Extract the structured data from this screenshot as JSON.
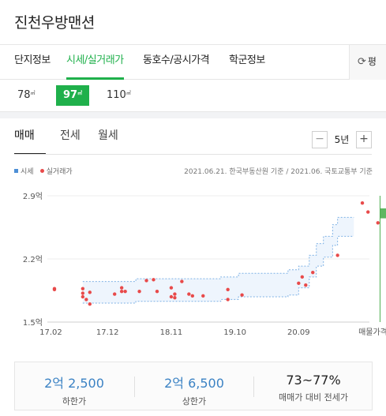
{
  "app": {
    "title": "진천우방맨션"
  },
  "tabs": [
    {
      "label": "단지정보",
      "active": false
    },
    {
      "label": "시세/실거래가",
      "active": true
    },
    {
      "label": "동호수/공시가격",
      "active": false
    },
    {
      "label": "학군정보",
      "active": false
    }
  ],
  "side_tab": {
    "icon": "refresh-icon",
    "label": "평"
  },
  "sizes": [
    {
      "label": "78",
      "unit": "㎡",
      "active": false
    },
    {
      "label": "97",
      "unit": "㎡",
      "active": true
    },
    {
      "label": "110",
      "unit": "㎡",
      "active": false
    }
  ],
  "deal_tabs": [
    {
      "label": "매매",
      "active": true
    },
    {
      "label": "전세",
      "active": false
    },
    {
      "label": "월세",
      "active": false
    }
  ],
  "period": {
    "minus": "−",
    "label": "5년",
    "plus": "+"
  },
  "legend": {
    "market": "시세",
    "actual": "실거래가"
  },
  "source_note": "2021.06.21. 한국부동산원 기준 / 2021.06. 국토교통부 기준",
  "chart_data": {
    "type": "line",
    "yticks": [
      "2.9억",
      "2.2억",
      "1.5억"
    ],
    "ylim": [
      1.5,
      2.9
    ],
    "xticks": [
      "17.02",
      "17.12",
      "18.11",
      "19.10",
      "20.09",
      "매물가격"
    ],
    "xlim": [
      2017.05,
      2021.6
    ],
    "series": [
      {
        "name": "시세",
        "band_upper": [
          [
            2017.55,
            1.95
          ],
          [
            2018.3,
            1.95
          ],
          [
            2018.3,
            1.98
          ],
          [
            2019.5,
            1.98
          ],
          [
            2019.5,
            2.0
          ],
          [
            2019.75,
            2.0
          ],
          [
            2019.75,
            2.04
          ],
          [
            2020.45,
            2.04
          ],
          [
            2020.45,
            2.08
          ],
          [
            2020.6,
            2.08
          ],
          [
            2020.6,
            2.12
          ],
          [
            2020.75,
            2.12
          ],
          [
            2020.75,
            2.24
          ],
          [
            2020.85,
            2.24
          ],
          [
            2020.85,
            2.37
          ],
          [
            2020.95,
            2.37
          ],
          [
            2020.95,
            2.45
          ],
          [
            2021.08,
            2.45
          ],
          [
            2021.08,
            2.58
          ],
          [
            2021.15,
            2.58
          ],
          [
            2021.15,
            2.66
          ],
          [
            2021.38,
            2.66
          ]
        ],
        "band_lower": [
          [
            2017.55,
            1.71
          ],
          [
            2018.3,
            1.71
          ],
          [
            2018.3,
            1.73
          ],
          [
            2019.5,
            1.73
          ],
          [
            2019.5,
            1.75
          ],
          [
            2019.75,
            1.75
          ],
          [
            2019.75,
            1.78
          ],
          [
            2020.45,
            1.78
          ],
          [
            2020.45,
            1.8
          ],
          [
            2020.6,
            1.8
          ],
          [
            2020.6,
            1.88
          ],
          [
            2020.75,
            1.88
          ],
          [
            2020.75,
            2.0
          ],
          [
            2020.85,
            2.0
          ],
          [
            2020.85,
            2.12
          ],
          [
            2020.95,
            2.12
          ],
          [
            2020.95,
            2.22
          ],
          [
            2021.08,
            2.22
          ],
          [
            2021.08,
            2.35
          ],
          [
            2021.15,
            2.35
          ],
          [
            2021.15,
            2.45
          ],
          [
            2021.38,
            2.45
          ]
        ]
      },
      {
        "name": "실거래가",
        "points": [
          [
            2017.15,
            1.87
          ],
          [
            2017.15,
            1.86
          ],
          [
            2017.55,
            1.87
          ],
          [
            2017.55,
            1.82
          ],
          [
            2017.55,
            1.78
          ],
          [
            2017.6,
            1.75
          ],
          [
            2017.65,
            1.83
          ],
          [
            2017.65,
            1.7
          ],
          [
            2018.0,
            1.81
          ],
          [
            2018.1,
            1.84
          ],
          [
            2018.1,
            1.88
          ],
          [
            2018.15,
            1.84
          ],
          [
            2018.35,
            1.84
          ],
          [
            2018.45,
            1.96
          ],
          [
            2018.55,
            1.97
          ],
          [
            2018.6,
            1.84
          ],
          [
            2018.8,
            1.88
          ],
          [
            2018.8,
            1.78
          ],
          [
            2018.85,
            1.81
          ],
          [
            2018.85,
            1.77
          ],
          [
            2018.95,
            1.95
          ],
          [
            2019.05,
            1.81
          ],
          [
            2019.1,
            1.79
          ],
          [
            2019.25,
            1.79
          ],
          [
            2019.6,
            1.86
          ],
          [
            2019.6,
            1.75
          ],
          [
            2019.8,
            1.8
          ],
          [
            2020.6,
            1.93
          ],
          [
            2020.65,
            2.0
          ],
          [
            2020.7,
            1.91
          ],
          [
            2020.8,
            2.05
          ],
          [
            2021.15,
            2.24
          ],
          [
            2021.5,
            2.82
          ],
          [
            2021.58,
            2.72
          ],
          [
            2021.72,
            2.6
          ]
        ]
      }
    ],
    "listing_range": [
      2.65,
      2.76
    ]
  },
  "summary": [
    {
      "value": "2억 2,500",
      "label": "하한가"
    },
    {
      "value": "2억 6,500",
      "label": "상한가"
    },
    {
      "value": "73~77%",
      "label": "매매가 대비 전세가"
    }
  ],
  "colors": {
    "accent": "#1fb04b",
    "band_stroke": "#7fb2e5",
    "band_fill": "#eef5fd",
    "deal_dot": "#e84a4a",
    "listing": "#4caf50"
  }
}
